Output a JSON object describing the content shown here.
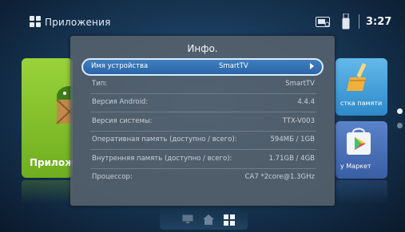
{
  "header": {
    "title": "Приложения",
    "clock": "3:27"
  },
  "tiles": {
    "apps_label": "Прилож",
    "clean_label": "стка памяти",
    "market_label": "у Маркет"
  },
  "dialog": {
    "title": "Инфо.",
    "rows": [
      {
        "key": "Имя устройства",
        "value": "SmartTV"
      },
      {
        "key": "Тип:",
        "value": "SmartTV"
      },
      {
        "key": "Версия Android:",
        "value": "4.4.4"
      },
      {
        "key": "Версия системы:",
        "value": "TTX-V003"
      },
      {
        "key": "Оперативная память (доступно / всего):",
        "value": "594МБ / 1GB"
      },
      {
        "key": "Внутренняя память (доступно / всего):",
        "value": "1.71GB / 4GB"
      },
      {
        "key": "Процессор:",
        "value": "CA7 *2core@1.3GHz"
      }
    ]
  },
  "colors": {
    "accent": "#2a65a8",
    "apps_tile": "#8cc63f",
    "clean_tile": "#4aa6de",
    "market_tile": "#4a70b8"
  },
  "icons": [
    "apps-icon",
    "sd-card-icon",
    "usb-icon",
    "android-icon",
    "broom-icon",
    "play-store-icon",
    "monitor-icon",
    "home-icon",
    "apps-grid-icon"
  ]
}
